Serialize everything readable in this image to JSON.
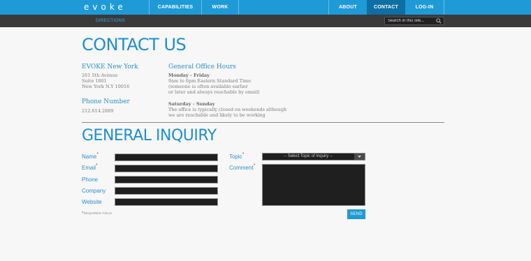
{
  "nav": {
    "logo": "evoke",
    "left_items": [
      {
        "label": "CAPABILITIES"
      },
      {
        "label": "WORK"
      }
    ],
    "right_items": [
      {
        "label": "ABOUT"
      },
      {
        "label": "CONTACT"
      },
      {
        "label": "LOG-IN"
      }
    ],
    "active": "CONTACT"
  },
  "subnav": {
    "directions": "DIRECTIONS",
    "search_placeholder": "Search in this site..."
  },
  "contact": {
    "heading": "CONTACT US",
    "office": {
      "title": "EVOKE New York",
      "lines": [
        "261 5th Avenue",
        "Suite 1801",
        "New York N.Y 10016"
      ]
    },
    "phone": {
      "title": "Phone Number",
      "number": "212.614.2889"
    },
    "hours": {
      "title": "General Office Hours",
      "weekday_label": "Monday - Friday",
      "weekday_lines": [
        "9am to 6pm Eastern Standard Time",
        "(someone is often available earlier",
        "or later and always reachable by email)"
      ],
      "weekend_label": "Saturday - Sunday",
      "weekend_lines": [
        "The office is typically closed on weekends although",
        "we are reachable and likely to be working"
      ]
    }
  },
  "inquiry": {
    "heading": "GENERAL INQUIRY",
    "fields": {
      "name": "Name",
      "email": "Email",
      "phone": "Phone",
      "company": "Company",
      "website": "Website",
      "topic": "Topic",
      "comment": "Comment"
    },
    "topic_selected": "-- Select Topic of Inquiry --",
    "required_note": "REQUIRED FIELD",
    "required_mark": "*",
    "send": "SEND"
  },
  "colors": {
    "nav_blue": "#1e9ad6",
    "nav_active": "#0e6fa4",
    "accent": "#1e8fcf",
    "required": "#e0312b"
  }
}
